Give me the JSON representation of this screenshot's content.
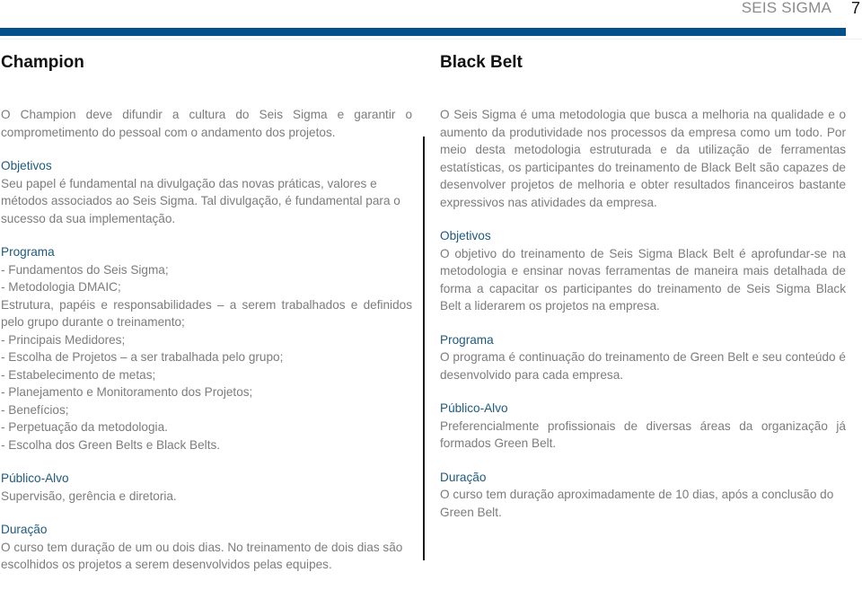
{
  "header": {
    "title": "SEIS SIGMA",
    "page_number": "7",
    "accent_color": "#03518a"
  },
  "left": {
    "title": "Champion",
    "intro": "O Champion deve difundir a cultura do Seis Sigma e garantir o comprometimento do pessoal com o andamento dos projetos.",
    "objetivos": {
      "heading": "Objetivos",
      "text": "Seu papel é fundamental na divulgação das novas práticas, valores e métodos associados ao Seis Sigma. Tal divulgação, é fundamental para o sucesso da sua implementação."
    },
    "programa": {
      "heading": "Programa",
      "items": [
        "- Fundamentos do Seis Sigma;",
        "- Metodologia DMAIC;",
        "Estrutura, papéis e responsabilidades – a serem trabalhados e definidos pelo grupo durante o treinamento;",
        "- Principais Medidores;",
        "- Escolha de Projetos – a ser trabalhada pelo grupo;",
        "- Estabelecimento de metas;",
        "- Planejamento e Monitoramento dos Projetos;",
        "- Benefícios;",
        "- Perpetuação da metodologia.",
        "- Escolha dos Green Belts e Black Belts."
      ]
    },
    "publico_alvo": {
      "heading": "Público-Alvo",
      "text": "Supervisão, gerência e diretoria."
    },
    "duracao": {
      "heading": "Duração",
      "text": "O curso tem duração de um ou dois dias. No treinamento de dois dias são escolhidos os projetos a serem desenvolvidos pelas equipes."
    }
  },
  "right": {
    "title": "Black Belt",
    "intro": "O Seis Sigma é uma metodologia que busca a melhoria na qualidade e o aumento da produtividade nos processos da empresa como um todo. Por meio desta metodologia estruturada e da utilização de ferramentas estatísticas, os participantes do treinamento de Black Belt são capazes de desenvolver projetos de melhoria e obter resultados financeiros bastante expressivos nas atividades da empresa.",
    "objetivos": {
      "heading": "Objetivos",
      "text": "O objetivo do treinamento de Seis Sigma Black Belt é aprofundar-se na metodologia e ensinar novas ferramentas de maneira mais detalhada de forma a capacitar os participantes do treinamento de Seis Sigma Black Belt a liderarem os projetos na empresa."
    },
    "programa": {
      "heading": "Programa",
      "text": "O programa é continuação do treinamento de Green Belt e seu conteúdo é desenvolvido para cada empresa."
    },
    "publico_alvo": {
      "heading": "Público-Alvo",
      "text": "Preferencialmente profissionais de diversas áreas da organização já formados Green Belt."
    },
    "duracao": {
      "heading": "Duração",
      "text": "O curso tem duração aproximadamente de 10 dias, após a conclusão do Green Belt."
    }
  }
}
